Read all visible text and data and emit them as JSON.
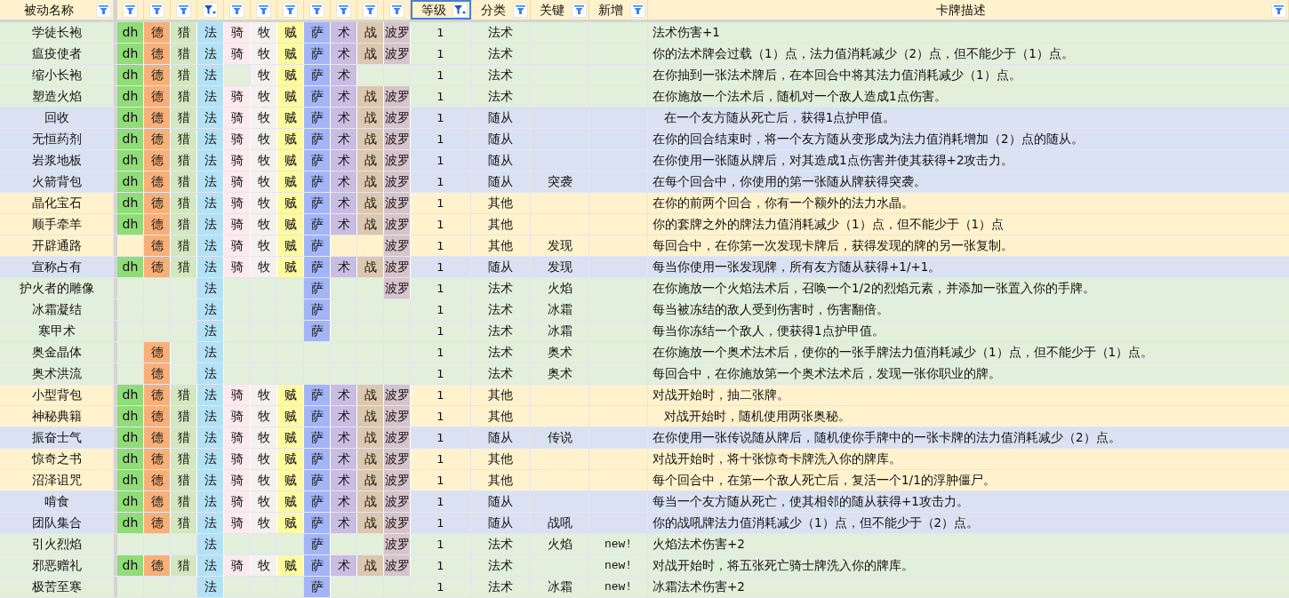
{
  "columns": [
    {
      "label": "被动名称",
      "filter_active": false
    },
    {
      "kind": "class",
      "filter_active": false,
      "color": "#8fdc78"
    },
    {
      "kind": "class",
      "filter_active": false,
      "color": "#f8b07a"
    },
    {
      "kind": "class",
      "filter_active": false,
      "color": "#d3e8c0"
    },
    {
      "kind": "class",
      "filter_active": true,
      "color": "#b3e1f5"
    },
    {
      "kind": "class",
      "filter_active": false,
      "color": "#fde9ee"
    },
    {
      "kind": "class",
      "filter_active": false,
      "color": "#f3f2ef"
    },
    {
      "kind": "class",
      "filter_active": false,
      "color": "#fffaa2"
    },
    {
      "kind": "class",
      "filter_active": false,
      "color": "#a3b5f7"
    },
    {
      "kind": "class",
      "filter_active": false,
      "color": "#c9bde2"
    },
    {
      "kind": "class",
      "filter_active": false,
      "color": "#dcc8ae"
    },
    {
      "kind": "class",
      "filter_active": false,
      "color": "#d6c3cb"
    },
    {
      "label": "等级",
      "filter_active": true,
      "selected": true
    },
    {
      "label": "分类",
      "filter_active": false,
      "selected": false
    },
    {
      "label": "关键",
      "filter_active": false,
      "selected": false
    },
    {
      "label": "新增",
      "filter_active": false,
      "selected": false
    },
    {
      "label": "卡牌描述",
      "filter_active": false,
      "selected": false
    }
  ],
  "rows": [
    {
      "name": "学徒长袍",
      "color": "#e2efda",
      "classes": [
        {
          "filled": true,
          "label": "dh"
        },
        {
          "filled": true,
          "label": "德"
        },
        {
          "filled": true,
          "label": "猎"
        },
        {
          "filled": true,
          "label": "法"
        },
        {
          "filled": true,
          "label": "骑"
        },
        {
          "filled": true,
          "label": "牧"
        },
        {
          "filled": true,
          "label": "贼"
        },
        {
          "filled": true,
          "label": "萨"
        },
        {
          "filled": true,
          "label": "术"
        },
        {
          "filled": true,
          "label": "战"
        },
        {
          "filled": true,
          "label": "波罗"
        }
      ],
      "level": "1",
      "category": "法术",
      "description": "法术伤害+1"
    },
    {
      "name": "瘟疫使者",
      "color": "#e2efda",
      "classes": [
        {
          "filled": true,
          "label": "dh"
        },
        {
          "filled": true,
          "label": "德"
        },
        {
          "filled": true,
          "label": "猎"
        },
        {
          "filled": true,
          "label": "法"
        },
        {
          "filled": true,
          "label": "骑"
        },
        {
          "filled": true,
          "label": "牧"
        },
        {
          "filled": true,
          "label": "贼"
        },
        {
          "filled": true,
          "label": "萨"
        },
        {
          "filled": true,
          "label": "术"
        },
        {
          "filled": true,
          "label": "战"
        },
        {
          "filled": true,
          "label": "波罗"
        }
      ],
      "level": "1",
      "category": "法术",
      "description": "你的法术牌会过载（1）点，法力值消耗减少（2）点，但不能少于（1）点。"
    },
    {
      "name": "缩小长袍",
      "color": "#e2efda",
      "classes": [
        {
          "filled": true,
          "label": "dh"
        },
        {
          "filled": true,
          "label": "德"
        },
        {
          "filled": true,
          "label": "猎"
        },
        {
          "filled": true,
          "label": "法"
        },
        {
          "filled": false
        },
        {
          "filled": true,
          "label": "牧"
        },
        {
          "filled": true,
          "label": "贼"
        },
        {
          "filled": true,
          "label": "萨"
        },
        {
          "filled": true,
          "label": "术"
        },
        {
          "filled": false
        },
        {
          "filled": false
        }
      ],
      "level": "1",
      "category": "法术",
      "description": "在你抽到一张法术牌后，在本回合中将其法力值消耗减少（1）点。"
    },
    {
      "name": "塑造火焰",
      "color": "#e2efda",
      "classes": [
        {
          "filled": true,
          "label": "dh"
        },
        {
          "filled": true,
          "label": "德"
        },
        {
          "filled": true,
          "label": "猎"
        },
        {
          "filled": true,
          "label": "法"
        },
        {
          "filled": true,
          "label": "骑"
        },
        {
          "filled": true,
          "label": "牧"
        },
        {
          "filled": true,
          "label": "贼"
        },
        {
          "filled": true,
          "label": "萨"
        },
        {
          "filled": true,
          "label": "术"
        },
        {
          "filled": true,
          "label": "战"
        },
        {
          "filled": true,
          "label": "波罗"
        }
      ],
      "level": "1",
      "category": "法术",
      "description": "在你施放一个法术后，随机对一个敌人造成1点伤害。"
    },
    {
      "name": "回收",
      "color": "#d9e1f2",
      "classes": [
        {
          "filled": true,
          "label": "dh"
        },
        {
          "filled": true,
          "label": "德"
        },
        {
          "filled": true,
          "label": "猎"
        },
        {
          "filled": true,
          "label": "法"
        },
        {
          "filled": true,
          "label": "骑"
        },
        {
          "filled": true,
          "label": "牧"
        },
        {
          "filled": true,
          "label": "贼"
        },
        {
          "filled": true,
          "label": "萨"
        },
        {
          "filled": true,
          "label": "术"
        },
        {
          "filled": true,
          "label": "战"
        },
        {
          "filled": true,
          "label": "波罗"
        }
      ],
      "level": "1",
      "category": "随从",
      "description": "   在一个友方随从死亡后，获得1点护甲值。"
    },
    {
      "name": "无恒药剂",
      "color": "#d9e1f2",
      "classes": [
        {
          "filled": true,
          "label": "dh"
        },
        {
          "filled": true,
          "label": "德"
        },
        {
          "filled": true,
          "label": "猎"
        },
        {
          "filled": true,
          "label": "法"
        },
        {
          "filled": true,
          "label": "骑"
        },
        {
          "filled": true,
          "label": "牧"
        },
        {
          "filled": true,
          "label": "贼"
        },
        {
          "filled": true,
          "label": "萨"
        },
        {
          "filled": true,
          "label": "术"
        },
        {
          "filled": true,
          "label": "战"
        },
        {
          "filled": true,
          "label": "波罗"
        }
      ],
      "level": "1",
      "category": "随从",
      "description": "在你的回合结束时，将一个友方随从变形成为法力值消耗增加（2）点的随从。"
    },
    {
      "name": "岩浆地板",
      "color": "#d9e1f2",
      "classes": [
        {
          "filled": true,
          "label": "dh"
        },
        {
          "filled": true,
          "label": "德"
        },
        {
          "filled": true,
          "label": "猎"
        },
        {
          "filled": true,
          "label": "法"
        },
        {
          "filled": true,
          "label": "骑"
        },
        {
          "filled": true,
          "label": "牧"
        },
        {
          "filled": true,
          "label": "贼"
        },
        {
          "filled": true,
          "label": "萨"
        },
        {
          "filled": true,
          "label": "术"
        },
        {
          "filled": true,
          "label": "战"
        },
        {
          "filled": true,
          "label": "波罗"
        }
      ],
      "level": "1",
      "category": "随从",
      "description": "在你使用一张随从牌后，对其造成1点伤害并使其获得+2攻击力。"
    },
    {
      "name": "火箭背包",
      "color": "#d9e1f2",
      "classes": [
        {
          "filled": true,
          "label": "dh"
        },
        {
          "filled": true,
          "label": "德"
        },
        {
          "filled": true,
          "label": "猎"
        },
        {
          "filled": true,
          "label": "法"
        },
        {
          "filled": true,
          "label": "骑"
        },
        {
          "filled": true,
          "label": "牧"
        },
        {
          "filled": true,
          "label": "贼"
        },
        {
          "filled": true,
          "label": "萨"
        },
        {
          "filled": true,
          "label": "术"
        },
        {
          "filled": true,
          "label": "战"
        },
        {
          "filled": true,
          "label": "波罗"
        }
      ],
      "level": "1",
      "category": "随从",
      "keyword": "突袭",
      "description": "在每个回合中，你使用的第一张随从牌获得突袭。"
    },
    {
      "name": "晶化宝石",
      "color": "#fff2cc",
      "classes": [
        {
          "filled": true,
          "label": "dh"
        },
        {
          "filled": true,
          "label": "德"
        },
        {
          "filled": true,
          "label": "猎"
        },
        {
          "filled": true,
          "label": "法"
        },
        {
          "filled": true,
          "label": "骑"
        },
        {
          "filled": true,
          "label": "牧"
        },
        {
          "filled": true,
          "label": "贼"
        },
        {
          "filled": true,
          "label": "萨"
        },
        {
          "filled": true,
          "label": "术"
        },
        {
          "filled": true,
          "label": "战"
        },
        {
          "filled": true,
          "label": "波罗"
        }
      ],
      "level": "1",
      "category": "其他",
      "description": "在你的前两个回合，你有一个额外的法力水晶。"
    },
    {
      "name": "顺手牵羊",
      "color": "#fff2cc",
      "classes": [
        {
          "filled": true,
          "label": "dh"
        },
        {
          "filled": true,
          "label": "德"
        },
        {
          "filled": true,
          "label": "猎"
        },
        {
          "filled": true,
          "label": "法"
        },
        {
          "filled": true,
          "label": "骑"
        },
        {
          "filled": true,
          "label": "牧"
        },
        {
          "filled": true,
          "label": "贼"
        },
        {
          "filled": true,
          "label": "萨"
        },
        {
          "filled": true,
          "label": "术"
        },
        {
          "filled": true,
          "label": "战"
        },
        {
          "filled": true,
          "label": "波罗"
        }
      ],
      "level": "1",
      "category": "其他",
      "description": "你的套牌之外的牌法力值消耗减少（1）点，但不能少于（1）点"
    },
    {
      "name": "开辟通路",
      "color": "#fff2cc",
      "classes": [
        {
          "filled": false
        },
        {
          "filled": true,
          "label": "德"
        },
        {
          "filled": true,
          "label": "猎"
        },
        {
          "filled": true,
          "label": "法"
        },
        {
          "filled": true,
          "label": "骑"
        },
        {
          "filled": true,
          "label": "牧"
        },
        {
          "filled": true,
          "label": "贼"
        },
        {
          "filled": true,
          "label": "萨"
        },
        {
          "filled": false
        },
        {
          "filled": false
        },
        {
          "filled": true,
          "label": "波罗"
        }
      ],
      "level": "1",
      "category": "其他",
      "keyword": "发现",
      "description": "每回合中，在你第一次发现卡牌后，获得发现的牌的另一张复制。"
    },
    {
      "name": "宣称占有",
      "color": "#d9e1f2",
      "classes": [
        {
          "filled": true,
          "label": "dh"
        },
        {
          "filled": true,
          "label": "德"
        },
        {
          "filled": true,
          "label": "猎"
        },
        {
          "filled": true,
          "label": "法"
        },
        {
          "filled": true,
          "label": "骑"
        },
        {
          "filled": true,
          "label": "牧"
        },
        {
          "filled": true,
          "label": "贼"
        },
        {
          "filled": true,
          "label": "萨"
        },
        {
          "filled": true,
          "label": "术"
        },
        {
          "filled": true,
          "label": "战"
        },
        {
          "filled": true,
          "label": "波罗"
        }
      ],
      "level": "1",
      "category": "随从",
      "keyword": "发现",
      "description": "每当你使用一张发现牌，所有友方随从获得+1/+1。"
    },
    {
      "name": "护火者的雕像",
      "color": "#e2efda",
      "classes": [
        {
          "filled": false
        },
        {
          "filled": false
        },
        {
          "filled": false
        },
        {
          "filled": true,
          "label": "法"
        },
        {
          "filled": false
        },
        {
          "filled": false
        },
        {
          "filled": false
        },
        {
          "filled": true,
          "label": "萨"
        },
        {
          "filled": false
        },
        {
          "filled": false
        },
        {
          "filled": true,
          "label": "波罗"
        }
      ],
      "level": "1",
      "category": "法术",
      "keyword": "火焰",
      "description": "在你施放一个火焰法术后，召唤一个1/2的烈焰元素，并添加一张置入你的手牌。"
    },
    {
      "name": "冰霜凝结",
      "color": "#e2efda",
      "classes": [
        {
          "filled": false
        },
        {
          "filled": false
        },
        {
          "filled": false
        },
        {
          "filled": true,
          "label": "法"
        },
        {
          "filled": false
        },
        {
          "filled": false
        },
        {
          "filled": false
        },
        {
          "filled": true,
          "label": "萨"
        },
        {
          "filled": false
        },
        {
          "filled": false
        },
        {
          "filled": false
        }
      ],
      "level": "1",
      "category": "法术",
      "keyword": "冰霜",
      "description": "每当被冻结的敌人受到伤害时，伤害翻倍。"
    },
    {
      "name": "寒甲术",
      "color": "#e2efda",
      "classes": [
        {
          "filled": false
        },
        {
          "filled": false
        },
        {
          "filled": false
        },
        {
          "filled": true,
          "label": "法"
        },
        {
          "filled": false
        },
        {
          "filled": false
        },
        {
          "filled": false
        },
        {
          "filled": true,
          "label": "萨"
        },
        {
          "filled": false
        },
        {
          "filled": false
        },
        {
          "filled": false
        }
      ],
      "level": "1",
      "category": "法术",
      "keyword": "冰霜",
      "description": "每当你冻结一个敌人，便获得1点护甲值。"
    },
    {
      "name": "奥金晶体",
      "color": "#e2efda",
      "classes": [
        {
          "filled": false
        },
        {
          "filled": true,
          "label": "德"
        },
        {
          "filled": false
        },
        {
          "filled": true,
          "label": "法"
        },
        {
          "filled": false
        },
        {
          "filled": false
        },
        {
          "filled": false
        },
        {
          "filled": false
        },
        {
          "filled": false
        },
        {
          "filled": false
        },
        {
          "filled": false
        }
      ],
      "level": "1",
      "category": "法术",
      "keyword": "奥术",
      "description": "在你施放一个奥术法术后，使你的一张手牌法力值消耗减少（1）点，但不能少于（1）点。"
    },
    {
      "name": "奥术洪流",
      "color": "#e2efda",
      "classes": [
        {
          "filled": false
        },
        {
          "filled": true,
          "label": "德"
        },
        {
          "filled": false
        },
        {
          "filled": true,
          "label": "法"
        },
        {
          "filled": false
        },
        {
          "filled": false
        },
        {
          "filled": false
        },
        {
          "filled": false
        },
        {
          "filled": false
        },
        {
          "filled": false
        },
        {
          "filled": false
        }
      ],
      "level": "1",
      "category": "法术",
      "keyword": "奥术",
      "description": "每回合中，在你施放第一个奥术法术后，发现一张你职业的牌。"
    },
    {
      "name": "小型背包",
      "color": "#fff2cc",
      "classes": [
        {
          "filled": true,
          "label": "dh"
        },
        {
          "filled": true,
          "label": "德"
        },
        {
          "filled": true,
          "label": "猎"
        },
        {
          "filled": true,
          "label": "法"
        },
        {
          "filled": true,
          "label": "骑"
        },
        {
          "filled": true,
          "label": "牧"
        },
        {
          "filled": true,
          "label": "贼"
        },
        {
          "filled": true,
          "label": "萨"
        },
        {
          "filled": true,
          "label": "术"
        },
        {
          "filled": true,
          "label": "战"
        },
        {
          "filled": true,
          "label": "波罗"
        }
      ],
      "level": "1",
      "category": "其他",
      "description": "对战开始时，抽二张牌。"
    },
    {
      "name": "神秘典籍",
      "color": "#fff2cc",
      "classes": [
        {
          "filled": true,
          "label": "dh"
        },
        {
          "filled": true,
          "label": "德"
        },
        {
          "filled": true,
          "label": "猎"
        },
        {
          "filled": true,
          "label": "法"
        },
        {
          "filled": true,
          "label": "骑"
        },
        {
          "filled": true,
          "label": "牧"
        },
        {
          "filled": true,
          "label": "贼"
        },
        {
          "filled": true,
          "label": "萨"
        },
        {
          "filled": true,
          "label": "术"
        },
        {
          "filled": true,
          "label": "战"
        },
        {
          "filled": true,
          "label": "波罗"
        }
      ],
      "level": "1",
      "category": "其他",
      "description": "   对战开始时，随机使用两张奥秘。"
    },
    {
      "name": "振奋士气",
      "color": "#d9e1f2",
      "classes": [
        {
          "filled": true,
          "label": "dh"
        },
        {
          "filled": true,
          "label": "德"
        },
        {
          "filled": true,
          "label": "猎"
        },
        {
          "filled": true,
          "label": "法"
        },
        {
          "filled": true,
          "label": "骑"
        },
        {
          "filled": true,
          "label": "牧"
        },
        {
          "filled": true,
          "label": "贼"
        },
        {
          "filled": true,
          "label": "萨"
        },
        {
          "filled": true,
          "label": "术"
        },
        {
          "filled": true,
          "label": "战"
        },
        {
          "filled": true,
          "label": "波罗"
        }
      ],
      "level": "1",
      "category": "随从",
      "keyword": "传说",
      "description": "在你使用一张传说随从牌后，随机使你手牌中的一张卡牌的法力值消耗减少（2）点。"
    },
    {
      "name": "惊奇之书",
      "color": "#fff2cc",
      "classes": [
        {
          "filled": true,
          "label": "dh"
        },
        {
          "filled": true,
          "label": "德"
        },
        {
          "filled": true,
          "label": "猎"
        },
        {
          "filled": true,
          "label": "法"
        },
        {
          "filled": true,
          "label": "骑"
        },
        {
          "filled": true,
          "label": "牧"
        },
        {
          "filled": true,
          "label": "贼"
        },
        {
          "filled": true,
          "label": "萨"
        },
        {
          "filled": true,
          "label": "术"
        },
        {
          "filled": true,
          "label": "战"
        },
        {
          "filled": true,
          "label": "波罗"
        }
      ],
      "level": "1",
      "category": "其他",
      "description": "对战开始时，将十张惊奇卡牌洗入你的牌库。"
    },
    {
      "name": "沼泽诅咒",
      "color": "#fff2cc",
      "classes": [
        {
          "filled": true,
          "label": "dh"
        },
        {
          "filled": true,
          "label": "德"
        },
        {
          "filled": true,
          "label": "猎"
        },
        {
          "filled": true,
          "label": "法"
        },
        {
          "filled": true,
          "label": "骑"
        },
        {
          "filled": true,
          "label": "牧"
        },
        {
          "filled": true,
          "label": "贼"
        },
        {
          "filled": true,
          "label": "萨"
        },
        {
          "filled": true,
          "label": "术"
        },
        {
          "filled": true,
          "label": "战"
        },
        {
          "filled": true,
          "label": "波罗"
        }
      ],
      "level": "1",
      "category": "其他",
      "description": "每个回合中，在第一个敌人死亡后，复活一个1/1的浮肿僵尸。"
    },
    {
      "name": "啃食",
      "color": "#d9e1f2",
      "classes": [
        {
          "filled": true,
          "label": "dh"
        },
        {
          "filled": true,
          "label": "德"
        },
        {
          "filled": true,
          "label": "猎"
        },
        {
          "filled": true,
          "label": "法"
        },
        {
          "filled": true,
          "label": "骑"
        },
        {
          "filled": true,
          "label": "牧"
        },
        {
          "filled": true,
          "label": "贼"
        },
        {
          "filled": true,
          "label": "萨"
        },
        {
          "filled": true,
          "label": "术"
        },
        {
          "filled": true,
          "label": "战"
        },
        {
          "filled": true,
          "label": "波罗"
        }
      ],
      "level": "1",
      "category": "随从",
      "description": "每当一个友方随从死亡，使其相邻的随从获得+1攻击力。"
    },
    {
      "name": "团队集合",
      "color": "#d9e1f2",
      "classes": [
        {
          "filled": true,
          "label": "dh"
        },
        {
          "filled": true,
          "label": "德"
        },
        {
          "filled": true,
          "label": "猎"
        },
        {
          "filled": true,
          "label": "法"
        },
        {
          "filled": true,
          "label": "骑"
        },
        {
          "filled": true,
          "label": "牧"
        },
        {
          "filled": true,
          "label": "贼"
        },
        {
          "filled": true,
          "label": "萨"
        },
        {
          "filled": true,
          "label": "术"
        },
        {
          "filled": true,
          "label": "战"
        },
        {
          "filled": true,
          "label": "波罗"
        }
      ],
      "level": "1",
      "category": "随从",
      "keyword": "战吼",
      "description": "你的战吼牌法力值消耗减少（1）点，但不能少于（2）点。"
    },
    {
      "name": "引火烈焰",
      "color": "#e2efda",
      "classes": [
        {
          "filled": false
        },
        {
          "filled": false
        },
        {
          "filled": false
        },
        {
          "filled": true,
          "label": "法"
        },
        {
          "filled": false
        },
        {
          "filled": false
        },
        {
          "filled": false
        },
        {
          "filled": true,
          "label": "萨"
        },
        {
          "filled": false
        },
        {
          "filled": false
        },
        {
          "filled": true,
          "label": "波罗"
        }
      ],
      "level": "1",
      "category": "法术",
      "keyword": "火焰",
      "new": "new!",
      "description": "火焰法术伤害+2"
    },
    {
      "name": "邪恶赠礼",
      "color": "#e2efda",
      "classes": [
        {
          "filled": true,
          "label": "dh"
        },
        {
          "filled": true,
          "label": "德"
        },
        {
          "filled": true,
          "label": "猎"
        },
        {
          "filled": true,
          "label": "法"
        },
        {
          "filled": true,
          "label": "骑"
        },
        {
          "filled": true,
          "label": "牧"
        },
        {
          "filled": true,
          "label": "贼"
        },
        {
          "filled": true,
          "label": "萨"
        },
        {
          "filled": true,
          "label": "术"
        },
        {
          "filled": true,
          "label": "战"
        },
        {
          "filled": true,
          "label": "波罗"
        }
      ],
      "level": "1",
      "category": "法术",
      "new": "new!",
      "description": "对战开始时，将五张死亡骑士牌洗入你的牌库。"
    },
    {
      "name": "极苦至寒",
      "color": "#e2efda",
      "classes": [
        {
          "filled": false
        },
        {
          "filled": false
        },
        {
          "filled": false
        },
        {
          "filled": true,
          "label": "法"
        },
        {
          "filled": false
        },
        {
          "filled": false
        },
        {
          "filled": false
        },
        {
          "filled": true,
          "label": "萨"
        },
        {
          "filled": false
        },
        {
          "filled": false
        },
        {
          "filled": false
        }
      ],
      "level": "1",
      "category": "法术",
      "keyword": "冰霜",
      "new": "new!",
      "description": "冰霜法术伤害+2"
    }
  ]
}
